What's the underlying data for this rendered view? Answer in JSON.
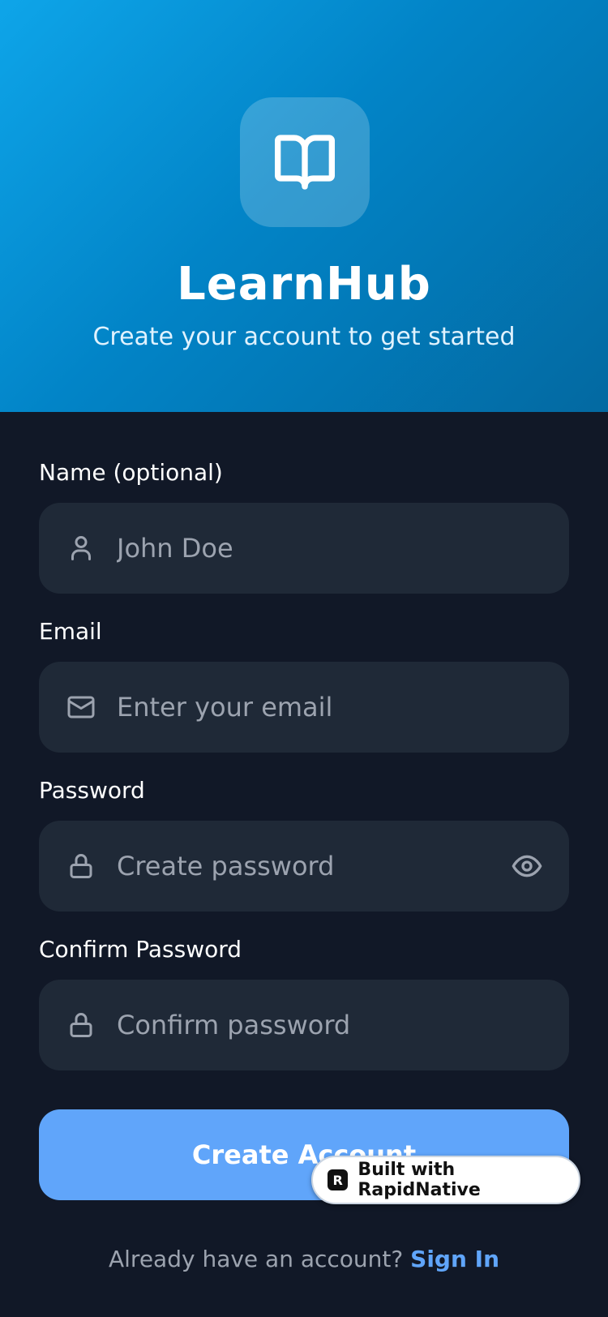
{
  "header": {
    "app_name": "LearnHub",
    "subtitle": "Create your account to get started",
    "logo_icon": "book-open-icon"
  },
  "form": {
    "name": {
      "label": "Name (optional)",
      "placeholder": "John Doe",
      "icon": "user-icon"
    },
    "email": {
      "label": "Email",
      "placeholder": "Enter your email",
      "icon": "mail-icon"
    },
    "password": {
      "label": "Password",
      "placeholder": "Create password",
      "icon": "lock-icon",
      "toggle_icon": "eye-icon"
    },
    "confirm_password": {
      "label": "Confirm Password",
      "placeholder": "Confirm password",
      "icon": "lock-icon"
    },
    "submit_label": "Create Account"
  },
  "badge": {
    "text": "Built with RapidNative",
    "logo_letter": "R"
  },
  "footer": {
    "prompt": "Already have an account? ",
    "link": "Sign In"
  },
  "colors": {
    "header_gradient_start": "#0ea5e9",
    "header_gradient_end": "#0369a1",
    "background": "#111827",
    "input_bg": "#1f2937",
    "accent": "#60a5fa",
    "placeholder": "#9ca3af"
  }
}
